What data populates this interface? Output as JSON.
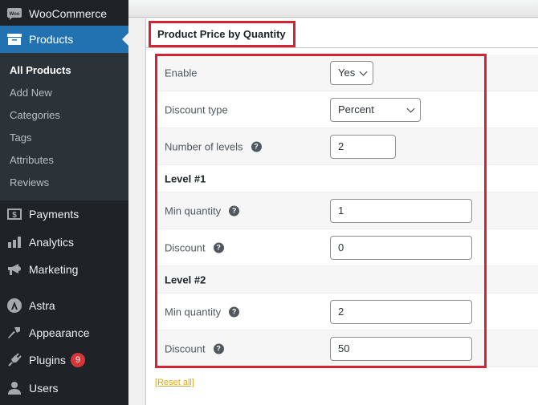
{
  "sidebar": {
    "items": [
      {
        "label": "WooCommerce",
        "icon": "woocommerce-icon"
      },
      {
        "label": "Products",
        "icon": "archive-box-icon",
        "active": true
      },
      {
        "label": "Payments",
        "icon": "dollar-card-icon"
      },
      {
        "label": "Analytics",
        "icon": "bar-chart-icon"
      },
      {
        "label": "Marketing",
        "icon": "megaphone-icon"
      },
      {
        "label": "Astra",
        "icon": "astra-icon"
      },
      {
        "label": "Appearance",
        "icon": "paintbrush-icon"
      },
      {
        "label": "Plugins",
        "icon": "plug-icon",
        "badge": "9"
      },
      {
        "label": "Users",
        "icon": "user-icon"
      }
    ],
    "submenu": [
      "All Products",
      "Add New",
      "Categories",
      "Tags",
      "Attributes",
      "Reviews"
    ],
    "current_submenu": "All Products"
  },
  "panel": {
    "title": "Product Price by Quantity",
    "rows": {
      "enable": {
        "label": "Enable",
        "value": "Yes"
      },
      "discount_type": {
        "label": "Discount type",
        "value": "Percent"
      },
      "levels": {
        "label": "Number of levels",
        "value": "2"
      },
      "level1": {
        "label": "Level #1"
      },
      "l1_min": {
        "label": "Min quantity",
        "value": "1"
      },
      "l1_discount": {
        "label": "Discount",
        "value": "0"
      },
      "level2": {
        "label": "Level #2"
      },
      "l2_min": {
        "label": "Min quantity",
        "value": "2"
      },
      "l2_discount": {
        "label": "Discount",
        "value": "50"
      }
    },
    "help_glyph": "?",
    "reset_label": "[Reset all]"
  },
  "colors": {
    "accent": "#2271b1",
    "highlight": "#d32433",
    "badge": "#d63638",
    "link": "#dba617"
  }
}
